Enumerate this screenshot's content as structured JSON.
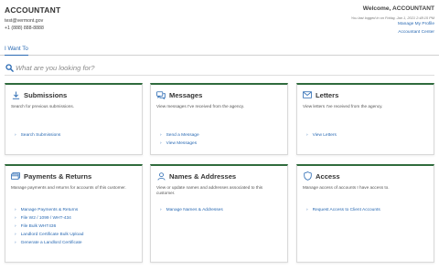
{
  "header": {
    "title": "ACCOUNTANT",
    "email": "test@vermont.gov",
    "phone": "+1 (888) 888-8888",
    "welcome": "Welcome, ACCOUNTANT",
    "last_login": "You last logged in on Friday, Jan 1, 2021 2:48:15 PM",
    "profile_link": "Manage My Profile",
    "center_link": "Accountant Center"
  },
  "tabs": {
    "active": "I Want To"
  },
  "search": {
    "placeholder": "What are you looking for?",
    "icon": "search-icon"
  },
  "colors": {
    "accent": "#2a6ab3",
    "card_border_top": "#2f6b3d"
  },
  "cards": [
    {
      "title": "Submissions",
      "icon": "download-icon",
      "description": "Search for previous submissions.",
      "links": [
        "Search Submissions"
      ]
    },
    {
      "title": "Messages",
      "icon": "chat-icon",
      "description": "View messages I've received from the agency.",
      "links": [
        "Send a Message",
        "View Messages"
      ]
    },
    {
      "title": "Letters",
      "icon": "envelope-icon",
      "description": "View letters I've received from the agency.",
      "links": [
        "View Letters"
      ]
    },
    {
      "title": "Payments & Returns",
      "icon": "payment-icon",
      "description": "Manage payments and returns for accounts of this customer.",
      "links": [
        "Manage Payments & Returns",
        "File W2 / 1099 / WHT-434",
        "File Bulk WHT436",
        "Landlord Certificate Bulk Upload",
        "Generate a Landlord Certificate"
      ]
    },
    {
      "title": "Names & Addresses",
      "icon": "person-icon",
      "description": "View or update names and addresses associated to this customer.",
      "links": [
        "Manage Names & Addresses"
      ]
    },
    {
      "title": "Access",
      "icon": "shield-icon",
      "description": "Manage access of accounts I have access to.",
      "links": [
        "Request Access to Client Accounts"
      ]
    }
  ]
}
